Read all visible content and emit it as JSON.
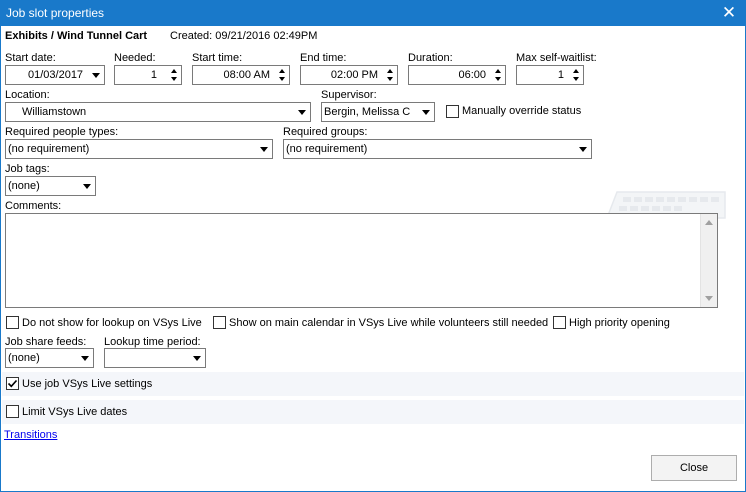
{
  "window": {
    "title": "Job slot properties"
  },
  "header": {
    "job_name": "Exhibits / Wind Tunnel Cart",
    "created": "Created: 09/21/2016 02:49PM"
  },
  "fields": {
    "start_date": {
      "label": "Start date:",
      "value": "01/03/2017"
    },
    "needed": {
      "label": "Needed:",
      "value": "1"
    },
    "start_time": {
      "label": "Start time:",
      "value": "08:00 AM"
    },
    "end_time": {
      "label": "End time:",
      "value": "02:00 PM"
    },
    "duration": {
      "label": "Duration:",
      "value": "06:00"
    },
    "max_waitlist": {
      "label": "Max self-waitlist:",
      "value": "1"
    },
    "location": {
      "label": "Location:",
      "value": "Williamstown"
    },
    "supervisor": {
      "label": "Supervisor:",
      "value": "Bergin, Melissa C"
    },
    "manual_override": {
      "label": "Manually override status",
      "checked": false
    },
    "people_types": {
      "label": "Required people types:",
      "value": "(no requirement)"
    },
    "groups": {
      "label": "Required groups:",
      "value": "(no requirement)"
    },
    "job_tags": {
      "label": "Job tags:",
      "value": "(none)"
    },
    "comments": {
      "label": "Comments:",
      "value": ""
    }
  },
  "options": {
    "no_lookup": {
      "label": "Do not show for lookup on VSys Live",
      "checked": false
    },
    "show_calendar": {
      "label": "Show on main calendar in VSys Live while volunteers still needed",
      "checked": false
    },
    "high_priority": {
      "label": "High priority opening",
      "checked": false
    },
    "share_feeds": {
      "label": "Job share feeds:",
      "value": "(none)"
    },
    "lookup_period": {
      "label": "Lookup time period:",
      "value": ""
    },
    "use_job_settings": {
      "label": "Use job VSys Live settings",
      "checked": true
    },
    "limit_dates": {
      "label": "Limit VSys Live dates",
      "checked": false
    }
  },
  "links": {
    "transitions": "Transitions"
  },
  "buttons": {
    "close": "Close"
  },
  "colors": {
    "titlebar": "#1979ca",
    "link": "#0000ee"
  }
}
